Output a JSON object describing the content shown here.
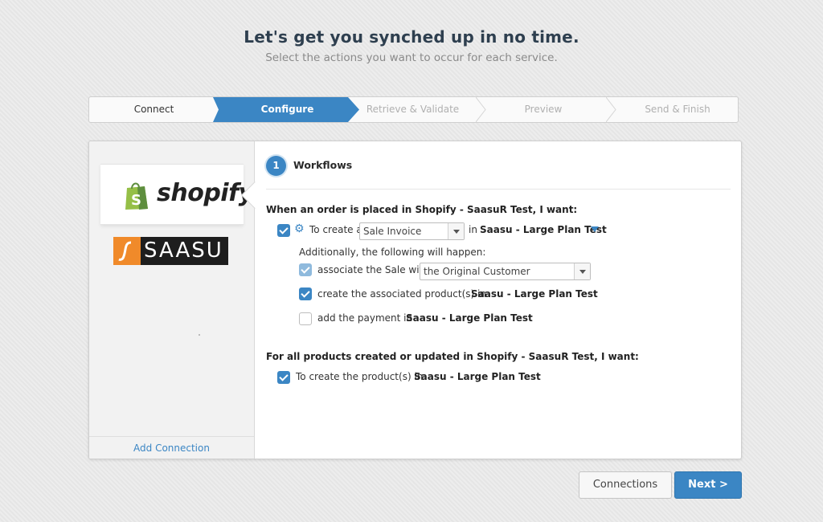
{
  "header": {
    "title": "Let's get you synched up in no time.",
    "subtitle": "Select the actions you want to occur for each service."
  },
  "steps": [
    {
      "label": "Connect",
      "state": "done"
    },
    {
      "label": "Configure",
      "state": "active"
    },
    {
      "label": "Retrieve & Validate",
      "state": "pending"
    },
    {
      "label": "Preview",
      "state": "pending"
    },
    {
      "label": "Send & Finish",
      "state": "pending"
    }
  ],
  "sidebar": {
    "connections": [
      {
        "name": "shopify",
        "logo_text": "shopify",
        "logo_icon": "shopping-bag-icon",
        "selected": true
      },
      {
        "name": "saasu",
        "logo_text": "SAASU",
        "logo_icon": "saasu-s-icon",
        "selected": false
      }
    ],
    "add_connection": "Add Connection"
  },
  "workflows": {
    "step_number": "1",
    "title": "Workflows",
    "order_section": {
      "heading": "When an order is placed in Shopify - SaasuR Test, I want:",
      "main_action": {
        "checked": true,
        "icon": "gear-icon",
        "prefix": "To create a",
        "select_value": "Sale Invoice",
        "in_text": "in",
        "target": "Saasu - Large Plan Test",
        "filter_icon": "filter-icon"
      },
      "additionally": "Additionally, the following will happen:",
      "sub_actions": [
        {
          "checked": true,
          "disabled": true,
          "text": "associate the Sale with",
          "select_value": "the Original Customer"
        },
        {
          "checked": true,
          "text": "create the associated product(s) in",
          "target": "Saasu - Large Plan Test"
        },
        {
          "checked": false,
          "text": "add the payment in",
          "target": "Saasu - Large Plan Test"
        }
      ]
    },
    "product_section": {
      "heading": "For all products created or updated in Shopify - SaasuR Test, I want:",
      "action": {
        "checked": true,
        "text": "To create the product(s) in",
        "target": "Saasu - Large Plan Test"
      }
    }
  },
  "buttons": {
    "connections": "Connections",
    "next": "Next >"
  },
  "colors": {
    "accent": "#3b86c4",
    "shopify_green": "#95bf47",
    "saasu_orange": "#f08a2a"
  }
}
